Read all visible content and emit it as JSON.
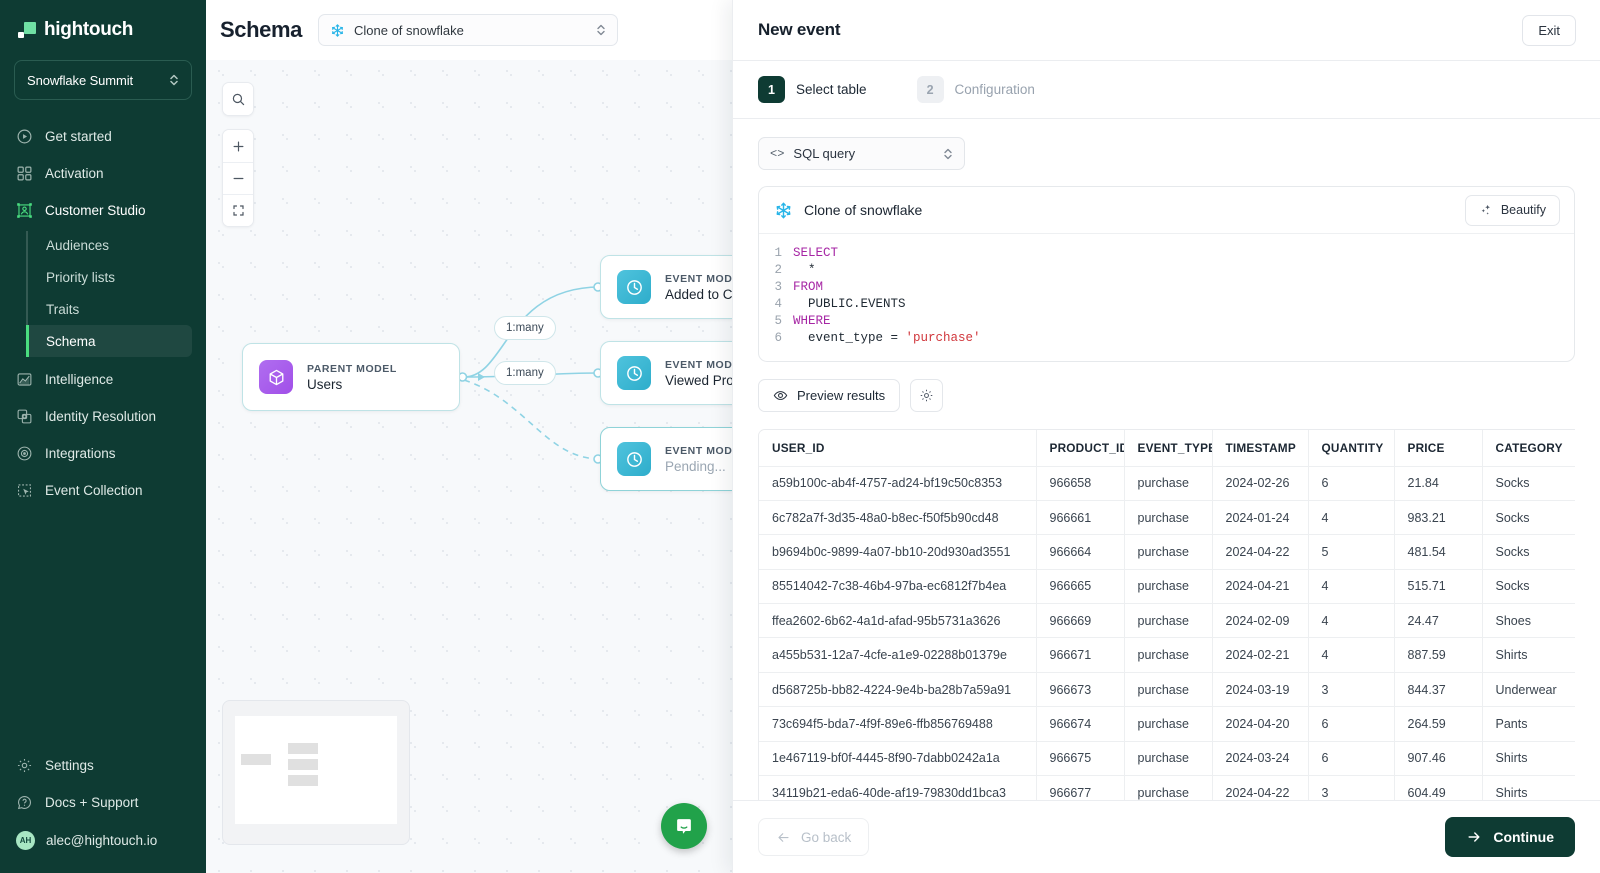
{
  "sidebar": {
    "brand": "hightouch",
    "workspace": {
      "name": "Snowflake Summit"
    },
    "items": [
      {
        "label": "Get started",
        "icon": "play-circle-icon"
      },
      {
        "label": "Activation",
        "icon": "grid-blocks-icon"
      },
      {
        "label": "Customer Studio",
        "icon": "customer-studio-icon"
      },
      {
        "label": "Intelligence",
        "icon": "chart-area-icon"
      },
      {
        "label": "Identity Resolution",
        "icon": "identity-icon"
      },
      {
        "label": "Integrations",
        "icon": "integrations-icon"
      },
      {
        "label": "Event Collection",
        "icon": "event-collection-icon"
      }
    ],
    "sub_items": [
      {
        "label": "Audiences"
      },
      {
        "label": "Priority lists"
      },
      {
        "label": "Traits"
      },
      {
        "label": "Schema"
      }
    ],
    "active_sub": "Schema",
    "bottom_items": [
      {
        "label": "Settings",
        "icon": "gear-icon"
      },
      {
        "label": "Docs + Support",
        "icon": "question-circle-icon"
      }
    ],
    "user": {
      "initials": "AH",
      "email": "alec@hightouch.io"
    }
  },
  "canvas": {
    "page_title": "Schema",
    "source_select": {
      "value": "Clone of snowflake",
      "icon": "snowflake-icon"
    },
    "tools": [
      {
        "name": "search-icon"
      },
      {
        "name": "zoom-in-icon"
      },
      {
        "name": "zoom-out-icon"
      },
      {
        "name": "fit-view-icon"
      }
    ],
    "nodes": [
      {
        "type": "PARENT MODEL",
        "name": "Users",
        "muted": false
      },
      {
        "type": "EVENT MOD",
        "name": "Added to Ca",
        "muted": false
      },
      {
        "type": "EVENT MOD",
        "name": "Viewed Pro",
        "muted": false
      },
      {
        "type": "EVENT MOD",
        "name": "Pending...",
        "muted": true
      }
    ],
    "edge_labels": [
      "1:many",
      "1:many"
    ]
  },
  "panel": {
    "title": "New event",
    "exit_label": "Exit",
    "steps": [
      {
        "num": "1",
        "label": "Select table",
        "state": "on"
      },
      {
        "num": "2",
        "label": "Configuration",
        "state": "off"
      }
    ],
    "type_select": {
      "value": "SQL query",
      "icon": "code-icon"
    },
    "editor": {
      "source_name": "Clone of snowflake",
      "source_icon": "snowflake-icon",
      "beautify_label": "Beautify",
      "beautify_icon": "sparkles-icon",
      "lines": [
        {
          "n": "1",
          "segments": [
            {
              "t": "SELECT",
              "c": "kw"
            }
          ]
        },
        {
          "n": "2",
          "segments": [
            {
              "t": "  *",
              "c": ""
            }
          ]
        },
        {
          "n": "3",
          "segments": [
            {
              "t": "FROM",
              "c": "kw"
            }
          ]
        },
        {
          "n": "4",
          "segments": [
            {
              "t": "  PUBLIC.EVENTS",
              "c": ""
            }
          ]
        },
        {
          "n": "5",
          "segments": [
            {
              "t": "WHERE",
              "c": "kw"
            }
          ]
        },
        {
          "n": "6",
          "segments": [
            {
              "t": "  event_type = ",
              "c": ""
            },
            {
              "t": "'purchase'",
              "c": "str"
            }
          ]
        }
      ]
    },
    "preview_label": "Preview results",
    "preview_icon": "eye-icon",
    "settings_icon": "gear-icon",
    "results": {
      "columns": [
        "USER_ID",
        "PRODUCT_ID",
        "EVENT_TYPE",
        "TIMESTAMP",
        "QUANTITY",
        "PRICE",
        "CATEGORY"
      ],
      "rows": [
        [
          "a59b100c-ab4f-4757-ad24-bf19c50c8353",
          "966658",
          "purchase",
          "2024-02-26",
          "6",
          "21.84",
          "Socks"
        ],
        [
          "6c782a7f-3d35-48a0-b8ec-f50f5b90cd48",
          "966661",
          "purchase",
          "2024-01-24",
          "4",
          "983.21",
          "Socks"
        ],
        [
          "b9694b0c-9899-4a07-bb10-20d930ad3551",
          "966664",
          "purchase",
          "2024-04-22",
          "5",
          "481.54",
          "Socks"
        ],
        [
          "85514042-7c38-46b4-97ba-ec6812f7b4ea",
          "966665",
          "purchase",
          "2024-04-21",
          "4",
          "515.71",
          "Socks"
        ],
        [
          "ffea2602-6b62-4a1d-afad-95b5731a3626",
          "966669",
          "purchase",
          "2024-02-09",
          "4",
          "24.47",
          "Shoes"
        ],
        [
          "a455b531-12a7-4cfe-a1e9-02288b01379e",
          "966671",
          "purchase",
          "2024-02-21",
          "4",
          "887.59",
          "Shirts"
        ],
        [
          "d568725b-bb82-4224-9e4b-ba28b7a59a91",
          "966673",
          "purchase",
          "2024-03-19",
          "3",
          "844.37",
          "Underwear"
        ],
        [
          "73c694f5-bda7-4f9f-89e6-ffb856769488",
          "966674",
          "purchase",
          "2024-04-20",
          "6",
          "264.59",
          "Pants"
        ],
        [
          "1e467119-bf0f-4445-8f90-7dabb0242a1a",
          "966675",
          "purchase",
          "2024-03-24",
          "6",
          "907.46",
          "Shirts"
        ],
        [
          "34119b21-eda6-40de-af19-79830dd1bca3",
          "966677",
          "purchase",
          "2024-04-22",
          "3",
          "604.49",
          "Shirts"
        ]
      ]
    },
    "footer": {
      "back_label": "Go back",
      "back_icon": "arrow-left-icon",
      "continue_label": "Continue",
      "continue_icon": "arrow-right-icon"
    }
  },
  "colors": {
    "brand_dark": "#0e3b33",
    "brand_green": "#4ade80",
    "accent_purple": "#a14fe8",
    "accent_teal": "#2eadcb",
    "snowflake_blue": "#29b5e8",
    "intercom_green": "#21a24a"
  }
}
